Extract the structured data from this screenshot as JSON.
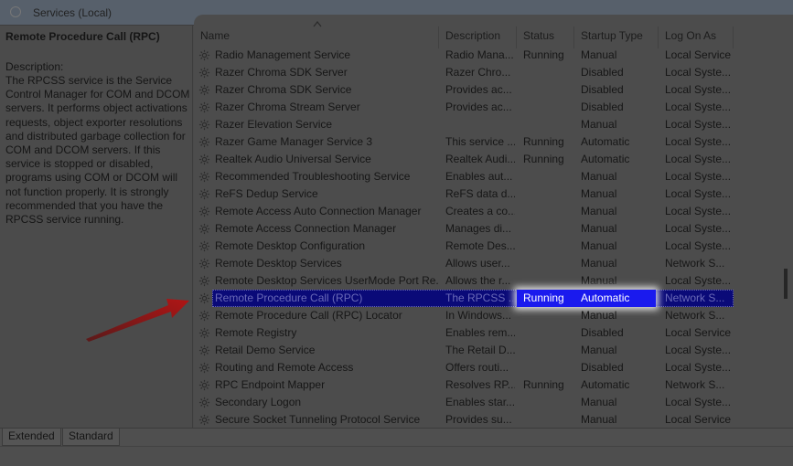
{
  "window": {
    "title": "Services (Local)"
  },
  "left_pane": {
    "service_title": "Remote Procedure Call (RPC)",
    "description_label": "Description:",
    "description_text": "The RPCSS service is the Service Control Manager for COM and DCOM servers. It performs object activations requests, object exporter resolutions and distributed garbage collection for COM and DCOM servers. If this service is stopped or disabled, programs using COM or DCOM will not function properly. It is strongly recommended that you have the RPCSS service running."
  },
  "columns": [
    {
      "key": "name",
      "label": "Name"
    },
    {
      "key": "description",
      "label": "Description"
    },
    {
      "key": "status",
      "label": "Status"
    },
    {
      "key": "startup",
      "label": "Startup Type"
    },
    {
      "key": "logon",
      "label": "Log On As"
    }
  ],
  "rows": [
    {
      "name": "Radio Management Service",
      "description": "Radio Mana...",
      "status": "Running",
      "startup": "Manual",
      "logon": "Local Service"
    },
    {
      "name": "Razer Chroma SDK Server",
      "description": "Razer Chro...",
      "status": "",
      "startup": "Disabled",
      "logon": "Local Syste..."
    },
    {
      "name": "Razer Chroma SDK Service",
      "description": "Provides ac...",
      "status": "",
      "startup": "Disabled",
      "logon": "Local Syste..."
    },
    {
      "name": "Razer Chroma Stream Server",
      "description": "Provides ac...",
      "status": "",
      "startup": "Disabled",
      "logon": "Local Syste..."
    },
    {
      "name": "Razer Elevation Service",
      "description": "",
      "status": "",
      "startup": "Manual",
      "logon": "Local Syste..."
    },
    {
      "name": "Razer Game Manager Service 3",
      "description": "This service ...",
      "status": "Running",
      "startup": "Automatic",
      "logon": "Local Syste..."
    },
    {
      "name": "Realtek Audio Universal Service",
      "description": "Realtek Audi...",
      "status": "Running",
      "startup": "Automatic",
      "logon": "Local Syste..."
    },
    {
      "name": "Recommended Troubleshooting Service",
      "description": "Enables aut...",
      "status": "",
      "startup": "Manual",
      "logon": "Local Syste..."
    },
    {
      "name": "ReFS Dedup Service",
      "description": "ReFS data d...",
      "status": "",
      "startup": "Manual",
      "logon": "Local Syste..."
    },
    {
      "name": "Remote Access Auto Connection Manager",
      "description": "Creates a co...",
      "status": "",
      "startup": "Manual",
      "logon": "Local Syste..."
    },
    {
      "name": "Remote Access Connection Manager",
      "description": "Manages di...",
      "status": "",
      "startup": "Manual",
      "logon": "Local Syste..."
    },
    {
      "name": "Remote Desktop Configuration",
      "description": "Remote Des...",
      "status": "",
      "startup": "Manual",
      "logon": "Local Syste..."
    },
    {
      "name": "Remote Desktop Services",
      "description": "Allows user...",
      "status": "",
      "startup": "Manual",
      "logon": "Network S..."
    },
    {
      "name": "Remote Desktop Services UserMode Port Re...",
      "description": "Allows the r...",
      "status": "",
      "startup": "Manual",
      "logon": "Local Syste..."
    },
    {
      "name": "Remote Procedure Call (RPC)",
      "description": "The RPCSS ...",
      "status": "Running",
      "startup": "Automatic",
      "logon": "Network S...",
      "selected": true
    },
    {
      "name": "Remote Procedure Call (RPC) Locator",
      "description": "In Windows...",
      "status": "",
      "startup": "Manual",
      "logon": "Network S..."
    },
    {
      "name": "Remote Registry",
      "description": "Enables rem...",
      "status": "",
      "startup": "Disabled",
      "logon": "Local Service"
    },
    {
      "name": "Retail Demo Service",
      "description": "The Retail D...",
      "status": "",
      "startup": "Manual",
      "logon": "Local Syste..."
    },
    {
      "name": "Routing and Remote Access",
      "description": "Offers routi...",
      "status": "",
      "startup": "Disabled",
      "logon": "Local Syste..."
    },
    {
      "name": "RPC Endpoint Mapper",
      "description": "Resolves RP...",
      "status": "Running",
      "startup": "Automatic",
      "logon": "Network S..."
    },
    {
      "name": "Secondary Logon",
      "description": "Enables star...",
      "status": "",
      "startup": "Manual",
      "logon": "Local Syste..."
    },
    {
      "name": "Secure Socket Tunneling Protocol Service",
      "description": "Provides su...",
      "status": "",
      "startup": "Manual",
      "logon": "Local Service"
    }
  ],
  "tabs": [
    {
      "label": "Extended"
    },
    {
      "label": "Standard"
    }
  ],
  "colors": {
    "selection": "#0a0a78",
    "highlight_glow": "#1a1aee",
    "arrow": "#a01818"
  },
  "icons": {
    "row_icon": "gear-icon",
    "title_icon": "search-icon",
    "sort": "sort-ascending-icon",
    "pointer": "red-arrow-annotation"
  }
}
